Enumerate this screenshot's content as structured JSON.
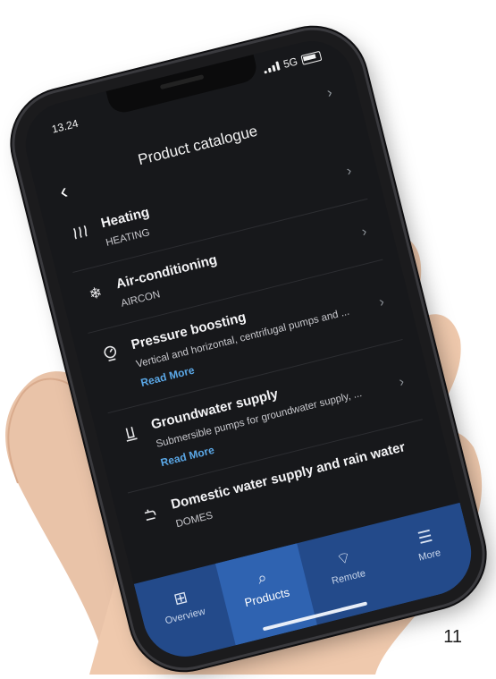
{
  "status": {
    "time": "13.24",
    "network": "5G"
  },
  "header": {
    "title": "Product catalogue"
  },
  "items": [
    {
      "name": "Heating",
      "sub": "HEATING",
      "icon": "heat-waves-icon"
    },
    {
      "name": "Air-conditioning",
      "sub": "AIRCON",
      "icon": "snowflake-icon"
    },
    {
      "name": "Pressure boosting",
      "sub": "Vertical and horizontal, centrifugal pumps and ...",
      "more": "Read More",
      "icon": "pressure-gauge-icon"
    },
    {
      "name": "Groundwater supply",
      "sub": "Submersible pumps for groundwater supply, ...",
      "more": "Read More",
      "icon": "well-pump-icon"
    },
    {
      "name": "Domestic water supply and rain water",
      "sub": "DOMES",
      "icon": "faucet-icon"
    }
  ],
  "tabs": [
    {
      "label": "Overview",
      "icon": "grid-icon"
    },
    {
      "label": "Products",
      "icon": "search-icon",
      "active": true
    },
    {
      "label": "Remote",
      "icon": "remote-wifi-icon"
    },
    {
      "label": "More",
      "icon": "menu-icon"
    }
  ],
  "page_number": "11",
  "colors": {
    "background": "#17181b",
    "tab_bar": "#234a8a",
    "tab_active": "#2f63b1",
    "link": "#5aa7e6"
  }
}
